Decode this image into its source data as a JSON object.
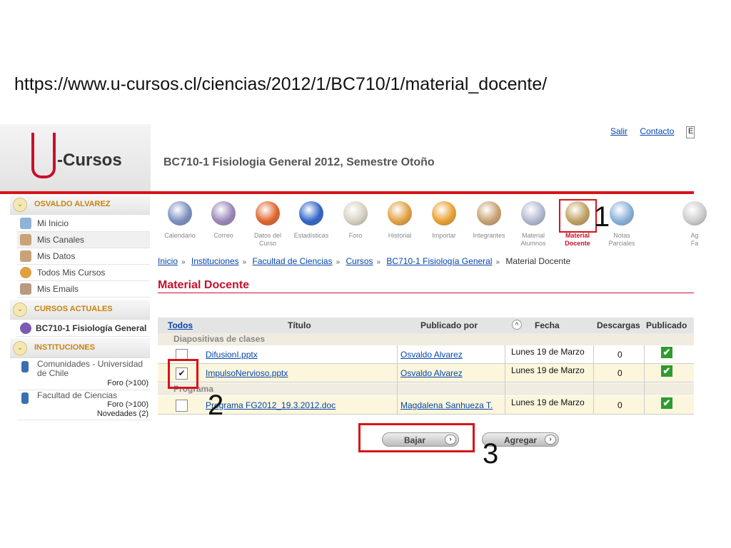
{
  "url": "https://www.u-cursos.cl/ciencias/2012/1/BC710/1/material_docente/",
  "logo": "-Cursos",
  "top_links": [
    "Salir",
    "Contacto"
  ],
  "lang_box": "E",
  "course_title": "BC710-1 Fisiologia General 2012, Semestre Otoño",
  "sidebar": {
    "user": "OSVALDO ALVAREZ",
    "user_items": [
      "Mi Inicio",
      "Mis Canales",
      "Mis Datos",
      "Todos Mis Cursos",
      "Mis Emails"
    ],
    "courses_title": "CURSOS ACTUALES",
    "course_item": "BC710-1 Fisiología General",
    "inst_title": "INSTITUCIONES",
    "inst1_name_l1": "Comunidades - Universidad",
    "inst1_name_l2": "de Chile",
    "inst1_foro": "Foro (>100)",
    "inst2_name": "Facultad de Ciencias",
    "inst2_foro": "Foro (>100)",
    "inst2_news": "Novedades (2)"
  },
  "toolbar": [
    {
      "l1": "Calendario",
      "l2": "",
      "icon": "calendar-icon",
      "color": "#7a8fc0"
    },
    {
      "l1": "Correo",
      "l2": "",
      "icon": "mail-icon",
      "color": "#9a86b8"
    },
    {
      "l1": "Datos del",
      "l2": "Curso",
      "icon": "course-data-icon",
      "color": "#e0632a"
    },
    {
      "l1": "Estadísticas",
      "l2": "",
      "icon": "stats-icon",
      "color": "#2f63c7"
    },
    {
      "l1": "Foro",
      "l2": "",
      "icon": "forum-icon",
      "color": "#d6d0c0"
    },
    {
      "l1": "Historial",
      "l2": "",
      "icon": "history-icon",
      "color": "#e0a040"
    },
    {
      "l1": "Importar",
      "l2": "",
      "icon": "import-icon",
      "color": "#e8a030"
    },
    {
      "l1": "Integrantes",
      "l2": "",
      "icon": "members-icon",
      "color": "#c9a070"
    },
    {
      "l1": "Material",
      "l2": "Alumnos",
      "icon": "student-material-icon",
      "color": "#b0b8d0"
    },
    {
      "l1": "Material",
      "l2": "Docente",
      "icon": "teacher-material-icon",
      "color": "#c0a060"
    },
    {
      "l1": "Notas",
      "l2": "Parciales",
      "icon": "grades-icon",
      "color": "#88b0d8"
    },
    {
      "l1": "Ag",
      "l2": "Fa",
      "icon": "favorites-icon",
      "color": "#cccccc"
    }
  ],
  "annotations": {
    "one": "1",
    "two": "2",
    "three": "3"
  },
  "breadcrumb": [
    "Inicio",
    "Instituciones",
    "Facultad de Ciencias",
    "Cursos",
    "BC710-1 Fisiología General",
    "Material Docente"
  ],
  "heading": "Material Docente",
  "table": {
    "headers": {
      "todos": "Todos",
      "titulo": "Título",
      "publicado_por": "Publicado por",
      "fecha": "Fecha",
      "descargas": "Descargas",
      "publicado": "Publicado"
    },
    "group1": "Diapositivas de clases",
    "group2": "Programa",
    "rows": [
      {
        "file": "DifusionI.pptx",
        "by": "Osvaldo Alvarez",
        "date": "Lunes 19 de Marzo",
        "downloads": "0",
        "checked": ""
      },
      {
        "file": "ImpulsoNervioso.pptx",
        "by": "Osvaldo Alvarez",
        "date": "Lunes 19 de Marzo",
        "downloads": "0",
        "checked": "✔"
      },
      {
        "file": "Programa FG2012_19.3.2012.doc",
        "by": "Magdalena Sanhueza T.",
        "date": "Lunes 19 de Marzo",
        "downloads": "0",
        "checked": ""
      }
    ]
  },
  "buttons": {
    "download": "Bajar",
    "add": "Agregar"
  }
}
